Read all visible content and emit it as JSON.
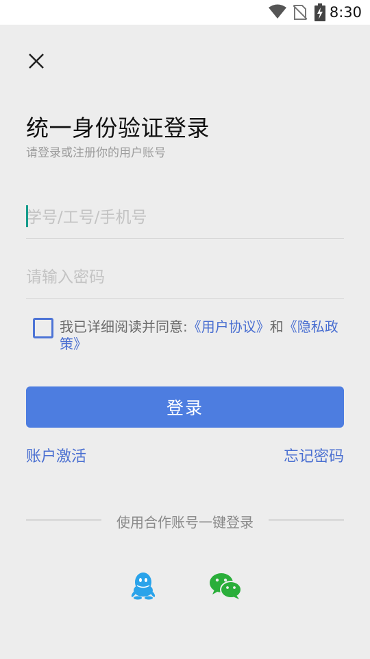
{
  "status_bar": {
    "time": "8:30",
    "icons": [
      "wifi-icon",
      "no-sim-icon",
      "battery-charging-icon"
    ]
  },
  "header": {
    "close_icon": "close-icon",
    "title": "统一身份验证登录",
    "subtitle": "请登录或注册你的用户账号"
  },
  "form": {
    "username": {
      "placeholder": "学号/工号/手机号",
      "value": ""
    },
    "password": {
      "placeholder": "请输入密码",
      "value": ""
    },
    "agreement": {
      "checked": false,
      "prefix": "我已详细阅读并同意:",
      "user_agreement": "《用户协议》",
      "and": "和",
      "privacy_policy": "《隐私政策》"
    },
    "login_label": "登录"
  },
  "links": {
    "activate": "账户激活",
    "forgot": "忘记密码"
  },
  "third_party": {
    "divider_text": "使用合作账号一键登录",
    "providers": [
      {
        "name": "qq",
        "icon": "qq-penguin-icon",
        "color": "#2aa3ea"
      },
      {
        "name": "wechat",
        "icon": "wechat-icon",
        "color": "#2aae3a"
      }
    ]
  },
  "colors": {
    "background": "#ededed",
    "accent": "#4d7de0",
    "link": "#4a6fd1",
    "cursor": "#169c8c"
  }
}
